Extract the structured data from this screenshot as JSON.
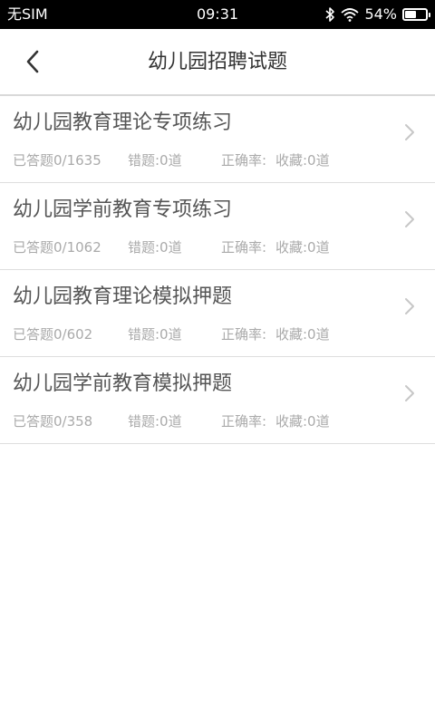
{
  "status_bar": {
    "carrier": "无SIM",
    "time": "09:31",
    "battery_percent": "54%",
    "battery_level": 0.54
  },
  "header": {
    "title": "幼儿园招聘试题",
    "back_icon": "chevron-left-icon"
  },
  "items": [
    {
      "title": "幼儿园教育理论专项练习",
      "answered": "已答题0/1635",
      "wrong": "错题:0道",
      "accuracy": "正确率:",
      "favorites": "收藏:0道"
    },
    {
      "title": "幼儿园学前教育专项练习",
      "answered": "已答题0/1062",
      "wrong": "错题:0道",
      "accuracy": "正确率:",
      "favorites": "收藏:0道"
    },
    {
      "title": "幼儿园教育理论模拟押题",
      "answered": "已答题0/602",
      "wrong": "错题:0道",
      "accuracy": "正确率:",
      "favorites": "收藏:0道"
    },
    {
      "title": "幼儿园学前教育模拟押题",
      "answered": "已答题0/358",
      "wrong": "错题:0道",
      "accuracy": "正确率:",
      "favorites": "收藏:0道"
    }
  ],
  "colors": {
    "status_bar_bg": "#000000",
    "divider": "#dedede",
    "title_text": "#555555",
    "meta_text": "#aaaaaa",
    "chevron": "#c7c7c7"
  }
}
